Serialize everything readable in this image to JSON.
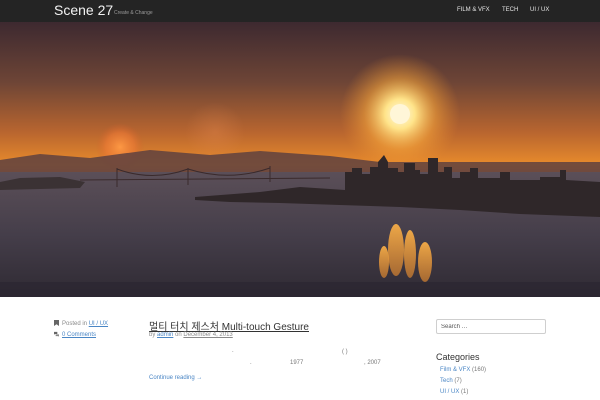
{
  "site": {
    "title": "Scene 27",
    "tagline": "Create & Change"
  },
  "nav": {
    "items": [
      {
        "label": "FILM & VFX"
      },
      {
        "label": "TECH"
      },
      {
        "label": "UI / UX"
      }
    ]
  },
  "post": {
    "posted_prefix": "Posted in",
    "category": "UI / UX",
    "comments": "0 Comments",
    "title": "멀티 터치 제스처 Multi-touch Gesture",
    "byline_prefix": "by",
    "author": "admin",
    "date_prefix": "on",
    "date": "December 4, 2013",
    "excerpt_line1": ".",
    "excerpt_line2_a": ".",
    "excerpt_line2_b": "1977",
    "excerpt_line2_c": "(    )",
    "excerpt_line2_d": ", 2007",
    "continue": "Continue reading →"
  },
  "sidebar": {
    "search_placeholder": "Search …",
    "categories_title": "Categories",
    "categories": [
      {
        "name": "Film & VFX",
        "count": "(160)"
      },
      {
        "name": "Tech",
        "count": "(7)"
      },
      {
        "name": "UI / UX",
        "count": "(1)"
      }
    ]
  },
  "colors": {
    "navbar": "#242424",
    "link": "#4a86c5",
    "sun": "#fff3c2",
    "sky_top": "#402a2a",
    "sky_horizon": "#e98a2c"
  },
  "icons": {
    "category": "bookmark-icon",
    "comments": "comments-icon"
  }
}
